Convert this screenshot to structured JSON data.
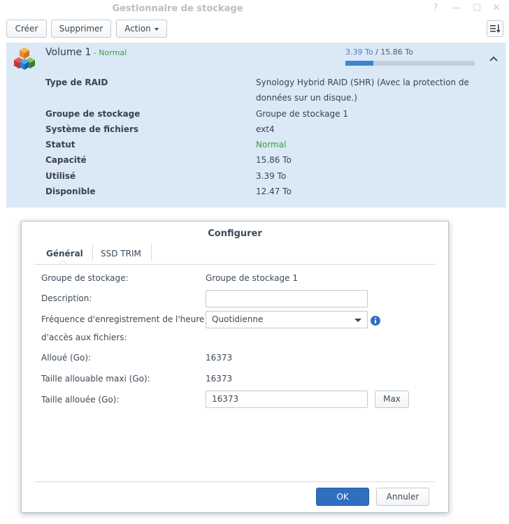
{
  "window": {
    "title": "Gestionnaire de stockage",
    "help_glyph": "?",
    "minimize_glyph": "—",
    "maximize_glyph": "☐",
    "close_glyph": "✕"
  },
  "toolbar": {
    "create_label": "Créer",
    "delete_label": "Supprimer",
    "action_label": "Action"
  },
  "volume": {
    "name": "Volume 1",
    "status_suffix": " - Normal",
    "usage_used": "3.39 To",
    "usage_sep": " / ",
    "usage_total": "15.86 To",
    "usage_fraction": 0.214,
    "rows": [
      {
        "label": "Type de RAID",
        "value": "Synology Hybrid RAID (SHR) (Avec la protection de données sur un disque.)"
      },
      {
        "label": "Groupe de stockage",
        "value": "Groupe de stockage 1"
      },
      {
        "label": "Système de fichiers",
        "value": "ext4"
      },
      {
        "label": "Statut",
        "value": "Normal"
      },
      {
        "label": "Capacité",
        "value": "15.86 To"
      },
      {
        "label": "Utilisé",
        "value": "3.39 To"
      },
      {
        "label": "Disponible",
        "value": "12.47 To"
      }
    ]
  },
  "dialog": {
    "title": "Configurer",
    "tabs": [
      "Général",
      "SSD TRIM"
    ],
    "fields": {
      "storage_group_label": "Groupe de stockage:",
      "storage_group_value": "Groupe de stockage 1",
      "description_label": "Description:",
      "description_value": "",
      "frequency_label_1": "Fréquence d'enregistrement de l'heure",
      "frequency_label_2": "d'accès aux fichiers:",
      "frequency_value": "Quotidienne",
      "allocated_label": "Alloué (Go):",
      "allocated_value": "16373",
      "max_alloc_label": "Taille allouable maxi (Go):",
      "max_alloc_value": "16373",
      "alloc_size_label": "Taille allouée (Go):",
      "alloc_size_value": "16373",
      "max_button": "Max"
    },
    "ok_label": "OK",
    "cancel_label": "Annuler"
  },
  "colors": {
    "accent": "#3b85cf",
    "status_green": "#3e9b45",
    "panel_bg": "#dbe8f6",
    "primary_button": "#2f6fc0"
  }
}
